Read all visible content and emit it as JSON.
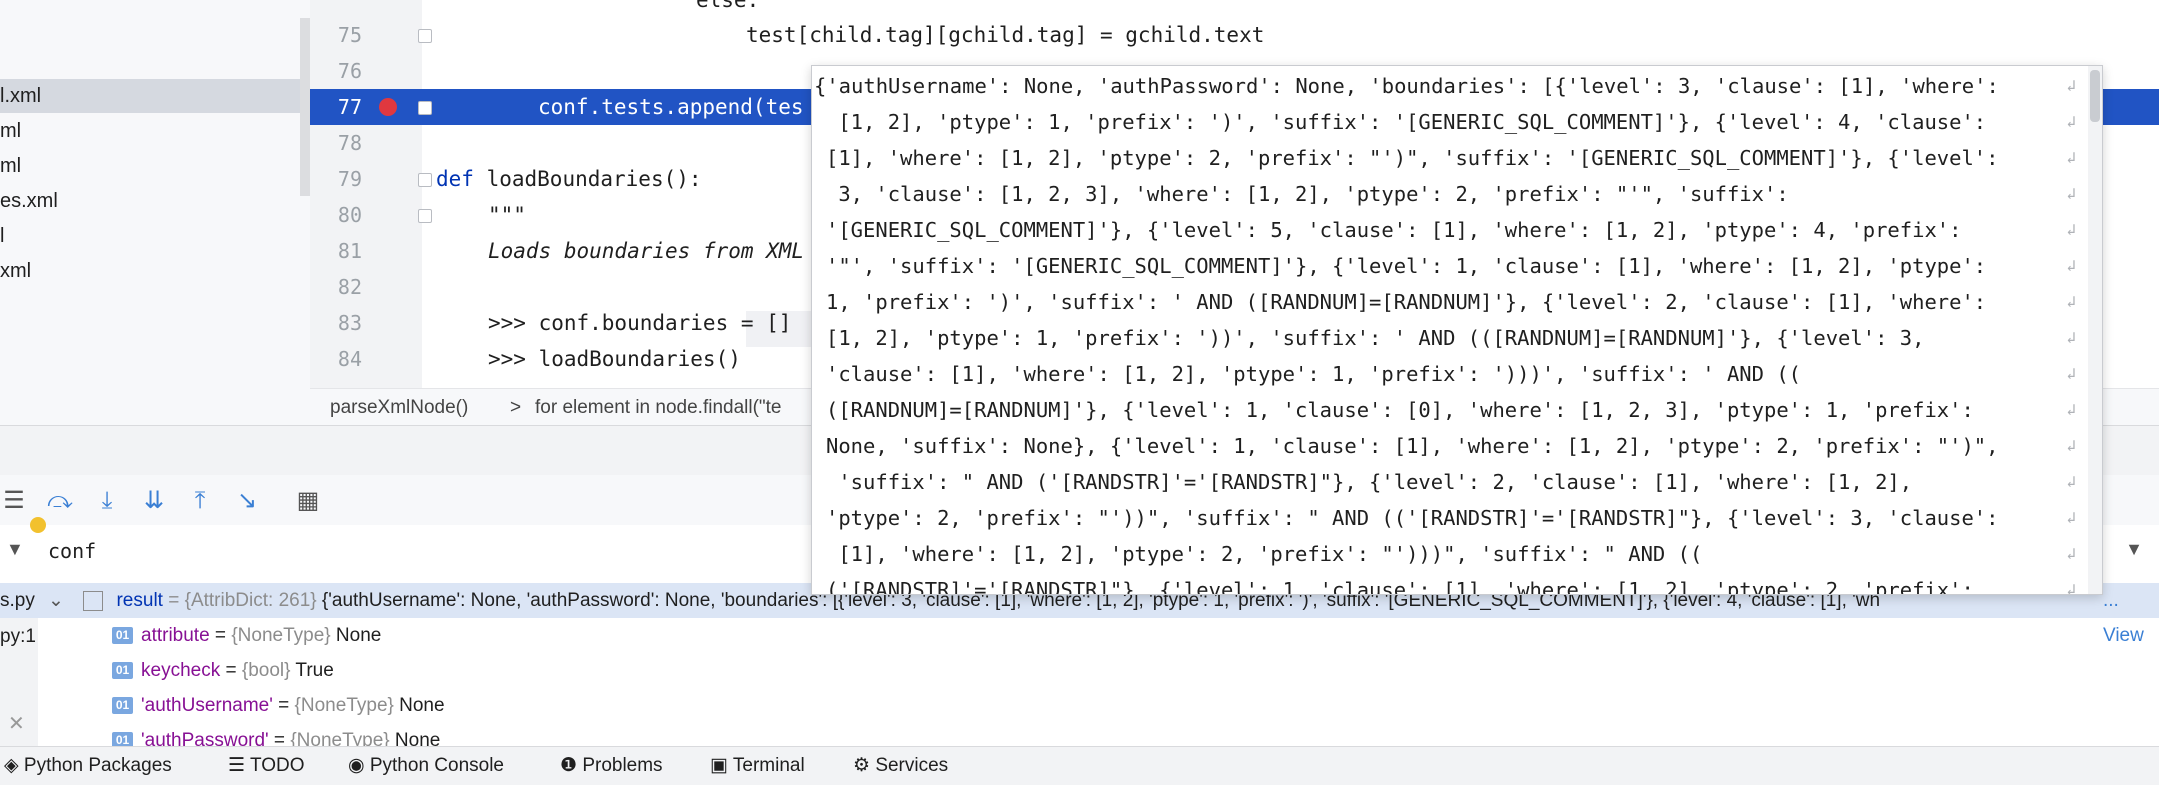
{
  "project_tree": {
    "items": [
      {
        "label": "l.xml",
        "selected": true
      },
      {
        "label": "ml",
        "selected": false
      },
      {
        "label": "ml",
        "selected": false
      },
      {
        "label": "es.xml",
        "selected": false
      },
      {
        "label": "l",
        "selected": false
      },
      {
        "label": "xml",
        "selected": false
      }
    ]
  },
  "editor": {
    "lines": [
      {
        "num": "",
        "code": "else:"
      },
      {
        "num": "75",
        "code": "test[child.tag][gchild.tag] = gchild.text"
      },
      {
        "num": "76",
        "code": ""
      },
      {
        "num": "77",
        "code": "conf.tests.append(tes"
      },
      {
        "num": "78",
        "code": ""
      },
      {
        "num": "79",
        "code_kw": "def",
        "code": " loadBoundaries():"
      },
      {
        "num": "80",
        "code": "\"\"\""
      },
      {
        "num": "81",
        "code": "Loads boundaries from XML"
      },
      {
        "num": "82",
        "code": ""
      },
      {
        "num": "83",
        "code": ">>> conf.boundaries = []"
      },
      {
        "num": "84",
        "code": ">>> loadBoundaries()"
      }
    ]
  },
  "breadcrumb": {
    "items": [
      "parseXmlNode()",
      ">",
      "for element in node.findall(\"te"
    ]
  },
  "debug": {
    "watch_value": "conf",
    "result_row": {
      "name": "result",
      "type": " = {AttribDict: 261} ",
      "value": "{'authUsername': None, 'authPassword': None, 'boundaries': [{'level': 3, 'clause': [1], 'where': [1, 2], 'ptype': 1, 'prefix': ')', 'suffix': '[GENERIC_SQL_COMMENT]'}, {'level': 4, 'clause': [1], 'wh",
      "view_link": "... View"
    },
    "frames": [
      "s.py",
      "py:1"
    ],
    "vars": [
      {
        "name": "attribute",
        "type": "{NoneType}",
        "value": "None"
      },
      {
        "name": "keycheck",
        "type": "{bool}",
        "value": "True"
      },
      {
        "name": "'authUsername'",
        "type": "{NoneType}",
        "value": "None"
      },
      {
        "name": "'authPassword'",
        "type": "{NoneType}",
        "value": "None"
      }
    ]
  },
  "popup": {
    "lines": [
      "{'authUsername': None, 'authPassword': None, 'boundaries': [{'level': 3, 'clause': [1], 'where':",
      " [1, 2], 'ptype': 1, 'prefix': ')', 'suffix': '[GENERIC_SQL_COMMENT]'}, {'level': 4, 'clause':",
      "[1], 'where': [1, 2], 'ptype': 2, 'prefix': \"')\", 'suffix': '[GENERIC_SQL_COMMENT]'}, {'level':",
      " 3, 'clause': [1, 2, 3], 'where': [1, 2], 'ptype': 2, 'prefix': \"'\", 'suffix':",
      "'[GENERIC_SQL_COMMENT]'}, {'level': 5, 'clause': [1], 'where': [1, 2], 'ptype': 4, 'prefix':",
      "'\"', 'suffix': '[GENERIC_SQL_COMMENT]'}, {'level': 1, 'clause': [1], 'where': [1, 2], 'ptype':",
      "1, 'prefix': ')', 'suffix': ' AND ([RANDNUM]=[RANDNUM]'}, {'level': 2, 'clause': [1], 'where':",
      "[1, 2], 'ptype': 1, 'prefix': '))', 'suffix': ' AND (([RANDNUM]=[RANDNUM]'}, {'level': 3,",
      "'clause': [1], 'where': [1, 2], 'ptype': 1, 'prefix': ')))', 'suffix': ' AND ((",
      "([RANDNUM]=[RANDNUM]'}, {'level': 1, 'clause': [0], 'where': [1, 2, 3], 'ptype': 1, 'prefix':",
      "None, 'suffix': None}, {'level': 1, 'clause': [1], 'where': [1, 2], 'ptype': 2, 'prefix': \"')\",",
      " 'suffix': \" AND ('[RANDSTR]'='[RANDSTR]\"}, {'level': 2, 'clause': [1], 'where': [1, 2],",
      "'ptype': 2, 'prefix': \"'))\", 'suffix': \" AND (('[RANDSTR]'='[RANDSTR]\"}, {'level': 3, 'clause':",
      " [1], 'where': [1, 2], 'ptype': 2, 'prefix': \"')))\", 'suffix': \" AND ((",
      "('[RANDSTR]'='[RANDSTR]\"}, {'level': 1, 'clause': [1], 'where': [1, 2], 'ptype': 2, 'prefix':"
    ]
  },
  "statusbar": {
    "items": [
      {
        "icon": "python-packages-icon",
        "label": "Python Packages"
      },
      {
        "icon": "todo-icon",
        "label": "TODO"
      },
      {
        "icon": "python-console-icon",
        "label": "Python Console"
      },
      {
        "icon": "problems-icon",
        "label": "Problems"
      },
      {
        "icon": "terminal-icon",
        "label": "Terminal"
      },
      {
        "icon": "services-icon",
        "label": "Services"
      }
    ]
  },
  "colors": {
    "selection_blue": "#2154c4",
    "breakpoint_red": "#e0383f",
    "keyword_blue": "#0033b3",
    "var_name_purple": "#871094"
  }
}
